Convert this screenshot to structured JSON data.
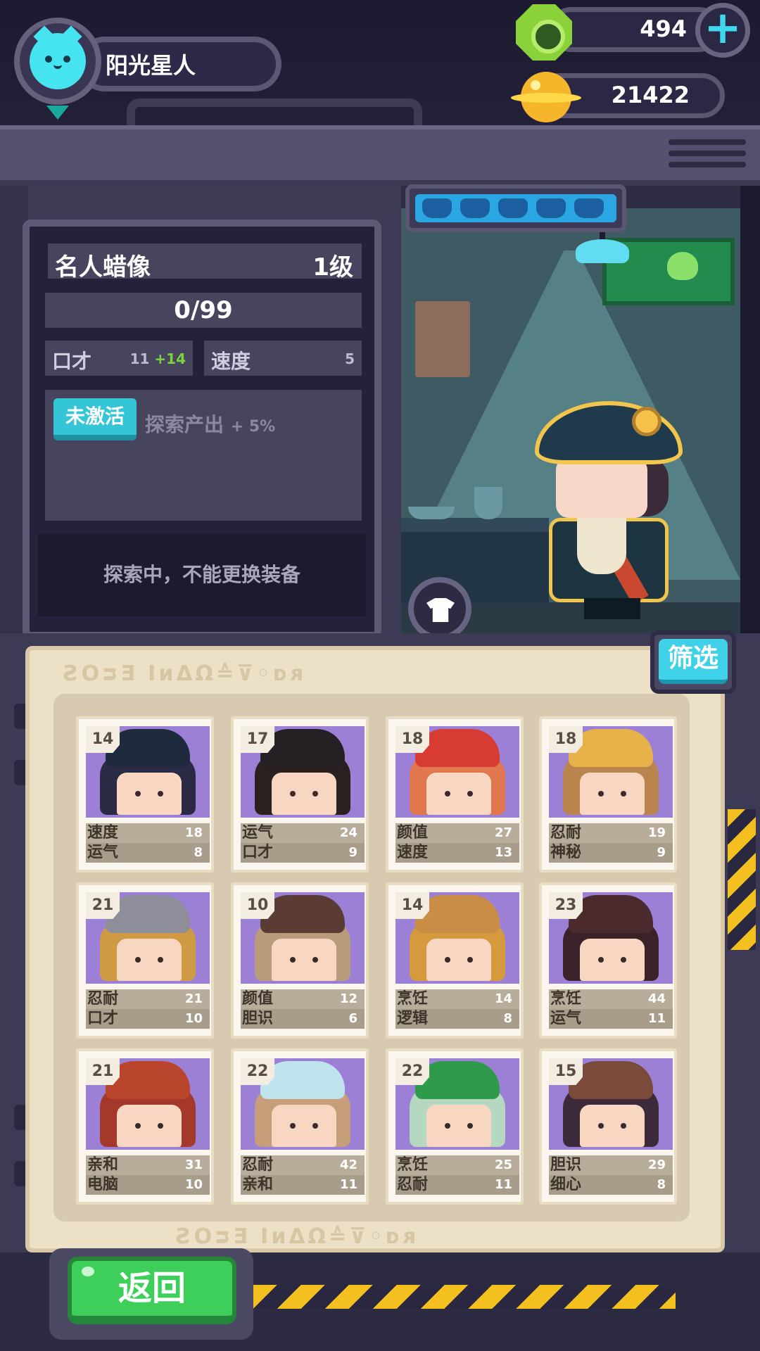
{
  "player": {
    "name": "阳光星人"
  },
  "currency": {
    "gems": "494",
    "coins": "21422"
  },
  "icons": {
    "gem": "green-gem-icon",
    "coin": "gold-planet-coin-icon",
    "add": "plus-icon",
    "avatar": "cat-face-icon",
    "outfit": "shirt-icon"
  },
  "item": {
    "name": "名人蜡像",
    "level": "1级",
    "progress": "0/99",
    "stats": [
      {
        "name": "口才",
        "value": "11",
        "bonus": "+14"
      },
      {
        "name": "速度",
        "value": "5",
        "bonus": ""
      }
    ],
    "skill": {
      "status": "未激活",
      "desc": "探索产出",
      "bonus": "+ 5%"
    },
    "notice": "探索中，不能更换装备"
  },
  "filter_label": "筛选",
  "back_label": "返回",
  "glyph_text": "ƧOᴝƎ IᴎΔΩ≙⊽◦ᴅᴙ",
  "characters": [
    {
      "level": "14",
      "stats": [
        {
          "name": "速度",
          "value": "18"
        },
        {
          "name": "运气",
          "value": "8"
        }
      ],
      "hat": "#1e2a3e",
      "hair": "#2b2a45"
    },
    {
      "level": "17",
      "stats": [
        {
          "name": "运气",
          "value": "24"
        },
        {
          "name": "口才",
          "value": "9"
        }
      ],
      "hat": "#242024",
      "hair": "#2b2020"
    },
    {
      "level": "18",
      "stats": [
        {
          "name": "颜值",
          "value": "27"
        },
        {
          "name": "速度",
          "value": "13"
        }
      ],
      "hat": "#d83a34",
      "hair": "#e0774e"
    },
    {
      "level": "18",
      "stats": [
        {
          "name": "忍耐",
          "value": "19"
        },
        {
          "name": "神秘",
          "value": "9"
        }
      ],
      "hat": "#e7b24a",
      "hair": "#b9844d"
    },
    {
      "level": "21",
      "stats": [
        {
          "name": "忍耐",
          "value": "21"
        },
        {
          "name": "口才",
          "value": "10"
        }
      ],
      "hat": "#8e8d9a",
      "hair": "#d09a44"
    },
    {
      "level": "10",
      "stats": [
        {
          "name": "颜值",
          "value": "12"
        },
        {
          "name": "胆识",
          "value": "6"
        }
      ],
      "hat": "#5a3c34",
      "hair": "#b89b7a"
    },
    {
      "level": "14",
      "stats": [
        {
          "name": "烹饪",
          "value": "14"
        },
        {
          "name": "逻辑",
          "value": "8"
        }
      ],
      "hat": "#c98d45",
      "hair": "#d69a3e"
    },
    {
      "level": "23",
      "stats": [
        {
          "name": "烹饪",
          "value": "44"
        },
        {
          "name": "运气",
          "value": "11"
        }
      ],
      "hat": "#4a2a2c",
      "hair": "#3a2228"
    },
    {
      "level": "21",
      "stats": [
        {
          "name": "亲和",
          "value": "31"
        },
        {
          "name": "电脑",
          "value": "10"
        }
      ],
      "hat": "#b9452d",
      "hair": "#a4382a"
    },
    {
      "level": "22",
      "stats": [
        {
          "name": "忍耐",
          "value": "42"
        },
        {
          "name": "亲和",
          "value": "11"
        }
      ],
      "hat": "#bfe4ee",
      "hair": "#c69f7a"
    },
    {
      "level": "22",
      "stats": [
        {
          "name": "烹饪",
          "value": "25"
        },
        {
          "name": "忍耐",
          "value": "11"
        }
      ],
      "hat": "#2f9b4a",
      "hair": "#b6d8c0"
    },
    {
      "level": "15",
      "stats": [
        {
          "name": "胆识",
          "value": "29"
        },
        {
          "name": "细心",
          "value": "8"
        }
      ],
      "hat": "#7a4a3a",
      "hair": "#3d2a3a"
    }
  ]
}
